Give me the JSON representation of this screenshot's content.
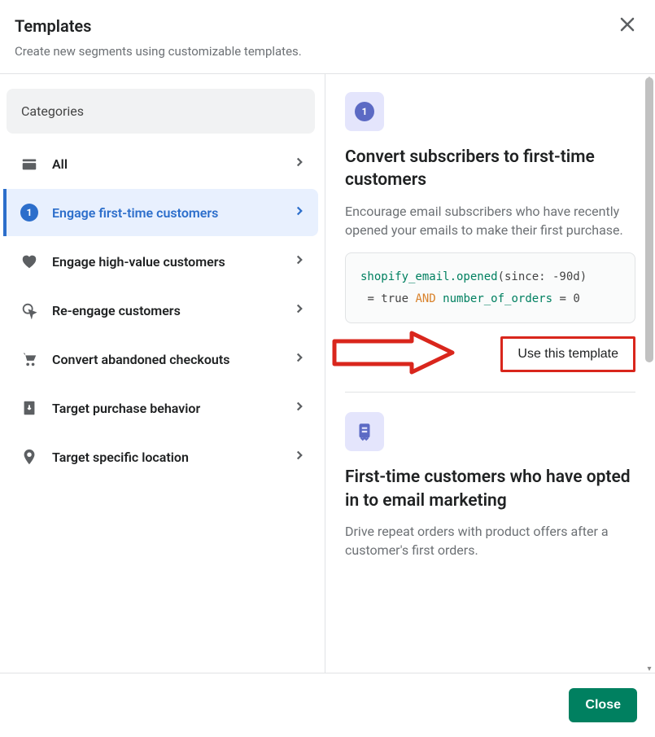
{
  "header": {
    "title": "Templates",
    "subtitle": "Create new segments using customizable templates."
  },
  "sidebar": {
    "categories_label": "Categories",
    "items": [
      {
        "label": "All",
        "icon": "wallet",
        "active": false
      },
      {
        "label": "Engage first-time customers",
        "icon": "badge-one",
        "active": true
      },
      {
        "label": "Engage high-value customers",
        "icon": "heart",
        "active": false
      },
      {
        "label": "Re-engage customers",
        "icon": "cursor-click",
        "active": false
      },
      {
        "label": "Convert abandoned checkouts",
        "icon": "cart",
        "active": false
      },
      {
        "label": "Target purchase behavior",
        "icon": "receipt-down",
        "active": false
      },
      {
        "label": "Target specific location",
        "icon": "pin",
        "active": false
      }
    ]
  },
  "templates": [
    {
      "icon": "badge-one",
      "title": "Convert subscribers to first-time customers",
      "desc": "Encourage email subscribers who have recently opened your emails to make their first purchase.",
      "code_parts": {
        "fn": "shopify_email.opened",
        "args": "(since: -90d)",
        "eq1": " = true ",
        "and": "AND",
        "fn2": " number_of_orders",
        "eq2": " = 0"
      },
      "button": "Use this template"
    },
    {
      "icon": "receipt",
      "title": "First-time customers who have opted in to email marketing",
      "desc": "Drive repeat orders with product offers after a customer's first orders."
    }
  ],
  "footer": {
    "close": "Close"
  }
}
